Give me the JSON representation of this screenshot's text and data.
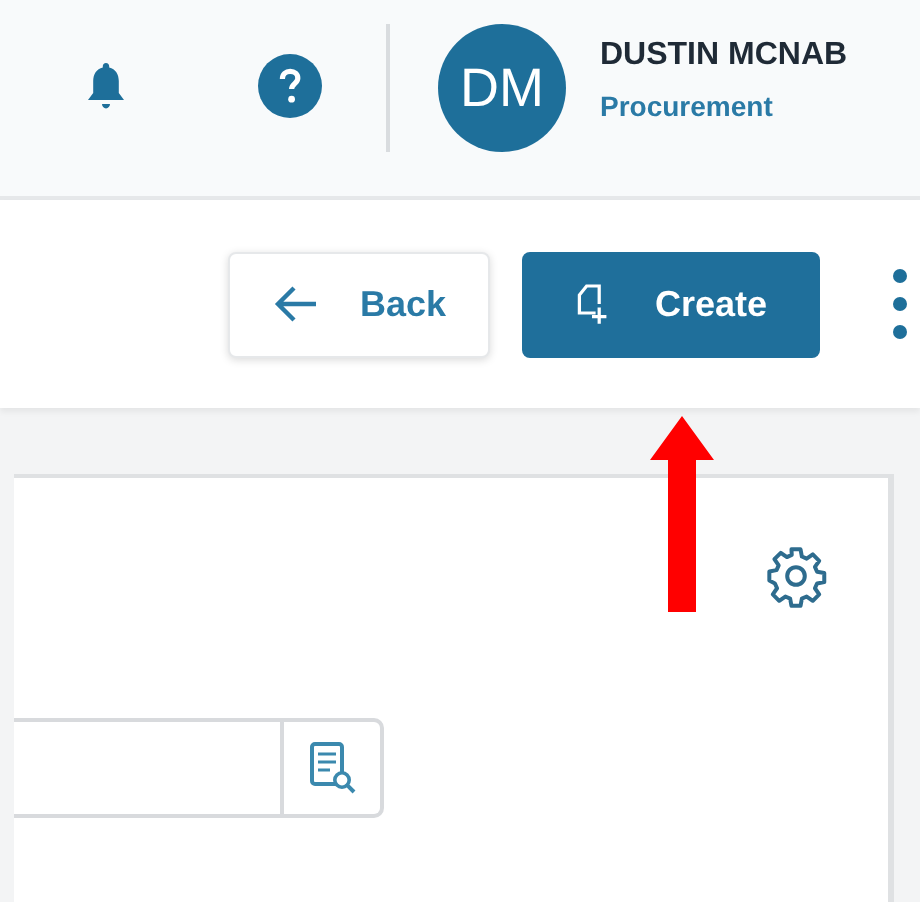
{
  "header": {
    "user": {
      "initials": "DM",
      "name": "DUSTIN MCNAB",
      "department": "Procurement"
    }
  },
  "toolbar": {
    "buttons": [
      {
        "kind": "back",
        "label": "Back"
      },
      {
        "kind": "create",
        "label": "Create"
      }
    ]
  }
}
